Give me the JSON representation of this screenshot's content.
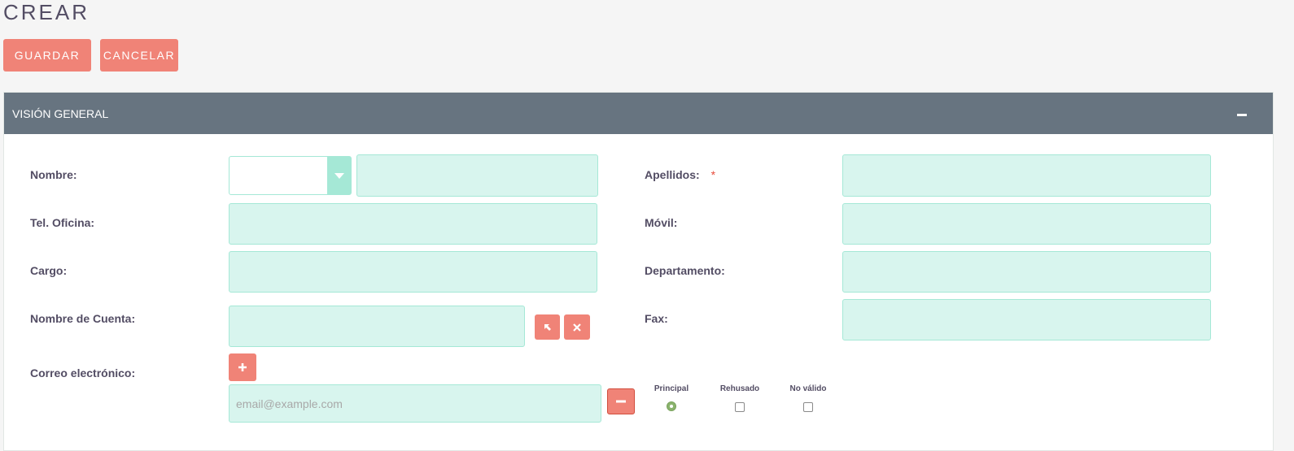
{
  "page": {
    "title": "CREAR"
  },
  "actions": {
    "save_label": "GUARDAR",
    "cancel_label": "CANCELAR"
  },
  "panel": {
    "title": "VISIÓN GENERAL"
  },
  "fields": {
    "nombre": {
      "label": "Nombre:",
      "salutation": "",
      "value": ""
    },
    "apellidos": {
      "label": "Apellidos:",
      "required_mark": "*",
      "value": ""
    },
    "tel_oficina": {
      "label": "Tel. Oficina:",
      "value": ""
    },
    "movil": {
      "label": "Móvil:",
      "value": ""
    },
    "cargo": {
      "label": "Cargo:",
      "value": ""
    },
    "departamento": {
      "label": "Departamento:",
      "value": ""
    },
    "nombre_cuenta": {
      "label": "Nombre de Cuenta:",
      "value": ""
    },
    "fax": {
      "label": "Fax:",
      "value": ""
    },
    "correo": {
      "label": "Correo electrónico:",
      "placeholder": "email@example.com",
      "value": "",
      "options": {
        "principal": "Principal",
        "rehusado": "Rehusado",
        "no_valido": "No válido"
      },
      "principal_selected": true,
      "rehusado_checked": false,
      "no_valido_checked": false
    }
  },
  "icons": {
    "select_account": "arrow-select-icon",
    "clear_account": "close-icon",
    "add_email": "plus-icon",
    "remove_email": "minus-icon",
    "collapse_panel": "minus-icon",
    "salutation_dropdown": "chevron-down-icon"
  },
  "colors": {
    "accent": "#f08377",
    "panel_header": "#677480",
    "field_bg": "#d8f5ee",
    "field_border": "#a5e8d6"
  }
}
